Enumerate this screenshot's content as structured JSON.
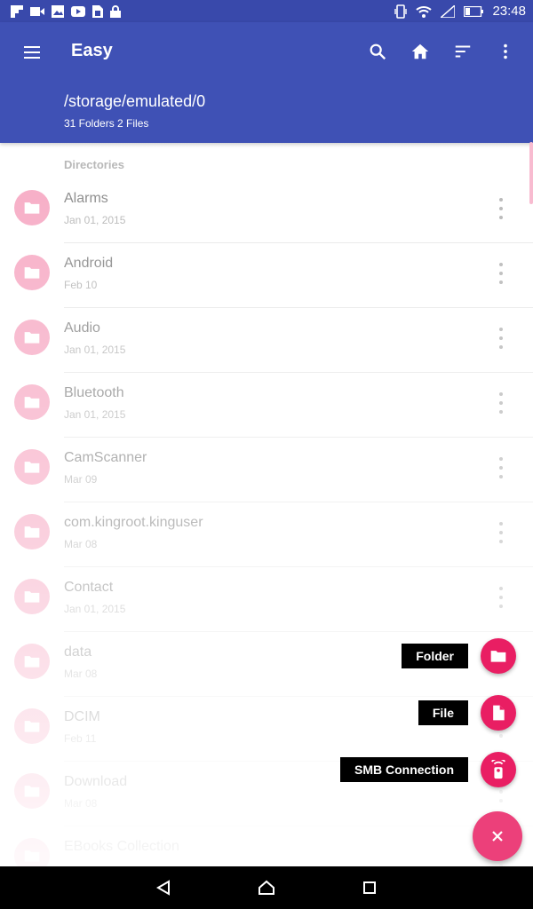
{
  "status_bar": {
    "time": "23:48",
    "left_icons": [
      "flipboard-icon",
      "video-icon",
      "image-icon",
      "youtube-icon",
      "sim-icon",
      "lock-icon"
    ],
    "right_icons": [
      "vibrate-icon",
      "wifi-icon",
      "signal-icon",
      "battery-icon"
    ]
  },
  "app_bar": {
    "title": "Easy",
    "path": "/storage/emulated/0",
    "counts": "31 Folders 2 Files",
    "actions": [
      "search-icon",
      "home-icon",
      "sort-icon",
      "more-vert-icon"
    ],
    "color": "#3f51b5"
  },
  "list": {
    "section_header": "Directories",
    "items": [
      {
        "name": "Alarms",
        "date": "Jan 01, 2015"
      },
      {
        "name": "Android",
        "date": "Feb 10"
      },
      {
        "name": "Audio",
        "date": "Jan 01, 2015"
      },
      {
        "name": "Bluetooth",
        "date": "Jan 01, 2015"
      },
      {
        "name": "CamScanner",
        "date": "Mar 09"
      },
      {
        "name": "com.kingroot.kinguser",
        "date": "Mar 08"
      },
      {
        "name": "Contact",
        "date": "Jan 01, 2015"
      },
      {
        "name": "data",
        "date": "Mar 08"
      },
      {
        "name": "DCIM",
        "date": "Feb 11"
      },
      {
        "name": "Download",
        "date": "Mar 08"
      },
      {
        "name": "EBooks Collection",
        "date": ""
      }
    ],
    "folder_color": "#f48fb1"
  },
  "fab_menu": {
    "folder_label": "Folder",
    "file_label": "File",
    "smb_label": "SMB Connection",
    "accent": "#e91e63"
  },
  "nav_bar": {
    "icons": [
      "back-icon",
      "home-icon",
      "recents-icon"
    ]
  }
}
